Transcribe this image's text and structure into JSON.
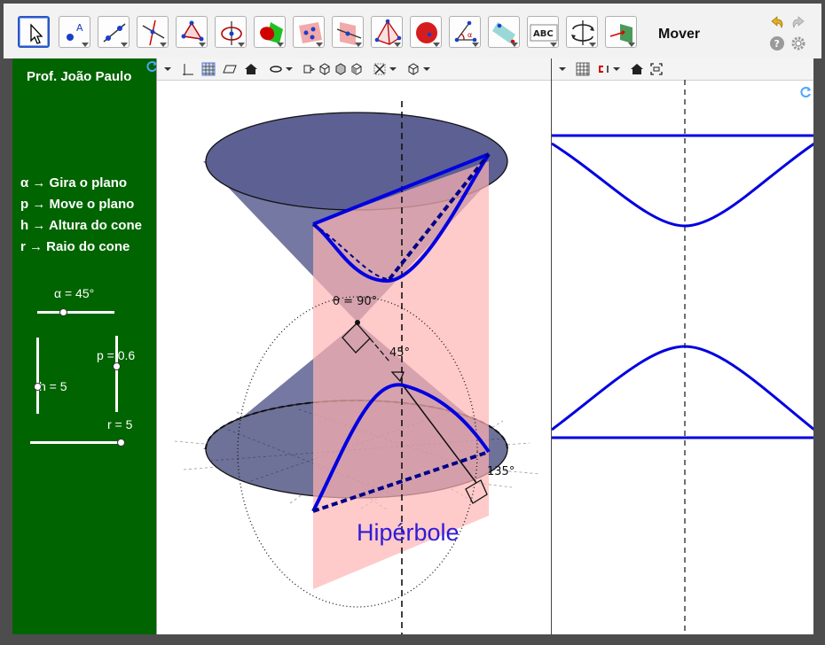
{
  "toolbar": {
    "tools": [
      "move-tool",
      "point-tool",
      "line-tool",
      "perpendicular-line-tool",
      "polygon-tool",
      "circle-tool",
      "intersect-surfaces-tool",
      "plane-through-points-tool",
      "perpendicular-plane-tool",
      "pyramid-tool",
      "sphere-tool",
      "angle-tool",
      "reflect-tool",
      "text-tool",
      "rotate-view-tool",
      "view-from-front-tool"
    ],
    "mode_label": "Mover"
  },
  "left_panel": {
    "author": "Prof. João Paulo",
    "legend": [
      "α → Gira o plano",
      "p → Move o plano",
      "h → Altura do cone",
      "r → Raio do cone"
    ],
    "sliders": {
      "alpha": {
        "label": "α = 45°",
        "value": 45
      },
      "p": {
        "label": "p = 0.6",
        "value": 0.6
      },
      "h": {
        "label": "h = 5",
        "value": 5
      },
      "r": {
        "label": "r = 5",
        "value": 5
      }
    }
  },
  "view3d": {
    "angle_theta_label": "θ = 90°",
    "angle_45_label": "45°",
    "angle_135_label": "135°",
    "curve_label": "Hipérbole",
    "colors": {
      "curve": "#0000e0",
      "plane": "#ffb4b4",
      "cone": "#6b6e96",
      "label": "#2f1bd6"
    }
  },
  "colors": {
    "panel_bg": "#006400",
    "frame": "#4d4d4d",
    "selected_tool": "#2a56c6"
  }
}
